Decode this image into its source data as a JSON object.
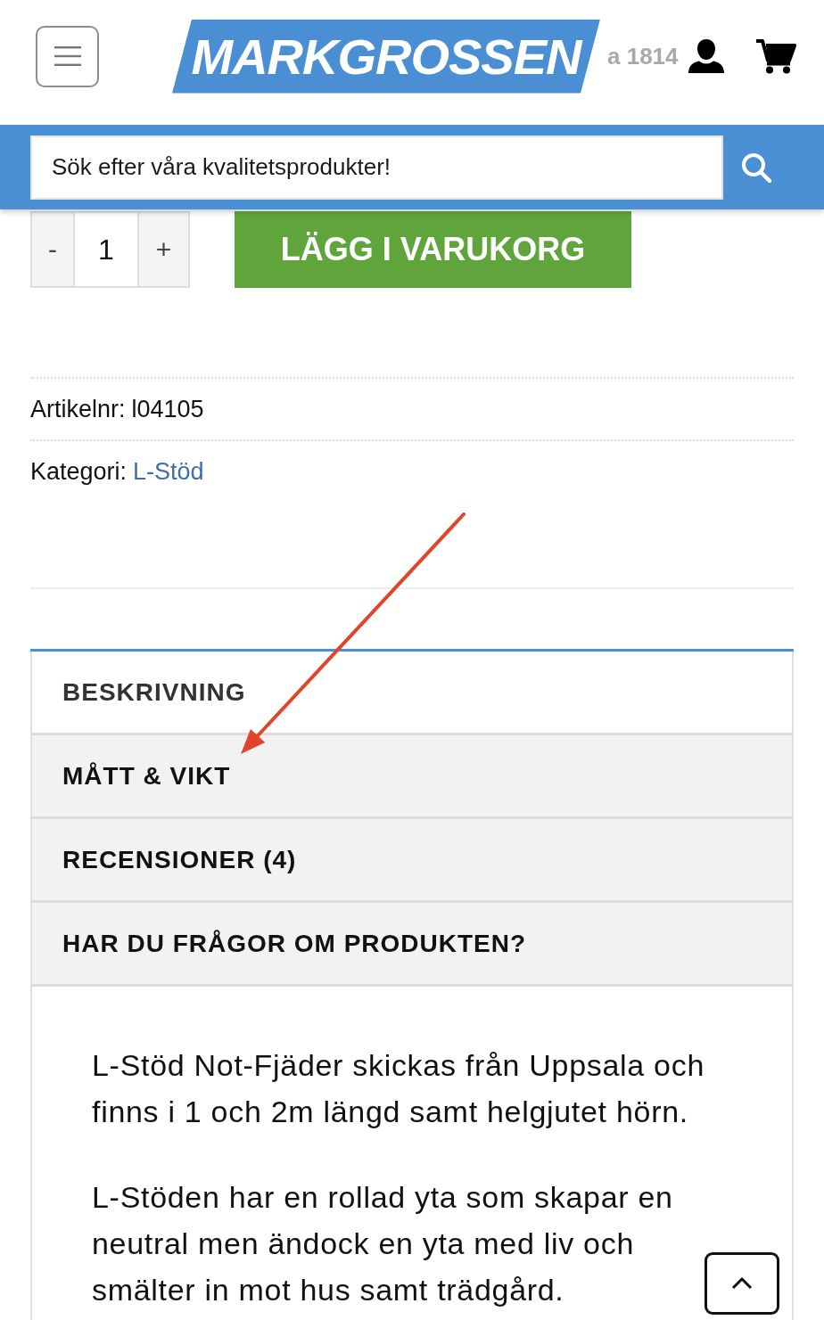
{
  "header": {
    "logo": "MARKGROSSEN",
    "tagline": "a 1814"
  },
  "search": {
    "placeholder": "Sök efter våra kvalitetsprodukter!"
  },
  "cart_form": {
    "minus": "-",
    "quantity": "1",
    "plus": "+",
    "add_button": "LÄGG I VARUKORG"
  },
  "meta": [
    {
      "kind": "text",
      "label": "Artikelnr:",
      "value": "l04105"
    },
    {
      "kind": "link",
      "label": "Kategori:",
      "value": "L-Stöd"
    }
  ],
  "tabs": [
    {
      "label": "BESKRIVNING",
      "selected": true
    },
    {
      "label": "MÅTT & VIKT",
      "selected": false
    },
    {
      "label": "RECENSIONER (4)",
      "selected": false
    },
    {
      "label": "HAR DU FRÅGOR OM PRODUKTEN?",
      "selected": false
    }
  ],
  "description": [
    "L-Stöd Not-Fjäder skickas från Uppsala och finns i 1 och 2m längd samt helgjutet hörn.",
    "L-Stöden har en rollad yta som skapar en neutral men ändock en yta med liv och smälter in mot hus samt trädgård."
  ]
}
